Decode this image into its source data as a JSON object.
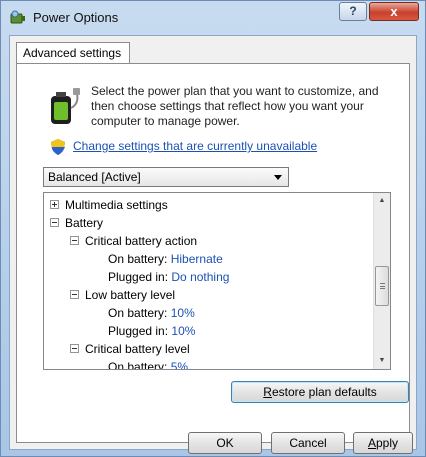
{
  "window": {
    "title": "Power Options",
    "help_label": "?",
    "close_label": "x"
  },
  "tab": {
    "label": "Advanced settings"
  },
  "intro": {
    "description": "Select the power plan that you want to customize, and then choose settings that reflect how you want your computer to manage power.",
    "change_link": "Change settings that are currently unavailable"
  },
  "plan_select": {
    "value": "Balanced [Active]"
  },
  "tree": {
    "multimedia": "Multimedia settings",
    "battery": "Battery",
    "critical_action": {
      "label": "Critical battery action",
      "on_battery_label": "On battery:",
      "on_battery_value": "Hibernate",
      "plugged_label": "Plugged in:",
      "plugged_value": "Do nothing"
    },
    "low_level": {
      "label": "Low battery level",
      "on_battery_label": "On battery:",
      "on_battery_value": "10%",
      "plugged_label": "Plugged in:",
      "plugged_value": "10%"
    },
    "critical_level": {
      "label": "Critical battery level",
      "on_battery_label": "On battery:",
      "on_battery_value": "5%"
    }
  },
  "buttons": {
    "restore_first": "R",
    "restore_rest": "estore plan defaults",
    "ok": "OK",
    "cancel": "Cancel",
    "apply_first": "A",
    "apply_rest": "pply"
  },
  "icons": {
    "app": "power-options-icon",
    "battery": "battery-plug-icon",
    "shield": "uac-shield-icon",
    "expand": "tree-expand-icon",
    "collapse": "tree-collapse-icon",
    "scroll_up": "scroll-up-arrow-icon",
    "scroll_down": "scroll-down-arrow-icon",
    "dropdown": "dropdown-arrow-icon"
  },
  "colors": {
    "link": "#1c51b4",
    "value": "#1c51b4",
    "title_bar": "#b9d1ea",
    "close": "#c7412c"
  }
}
